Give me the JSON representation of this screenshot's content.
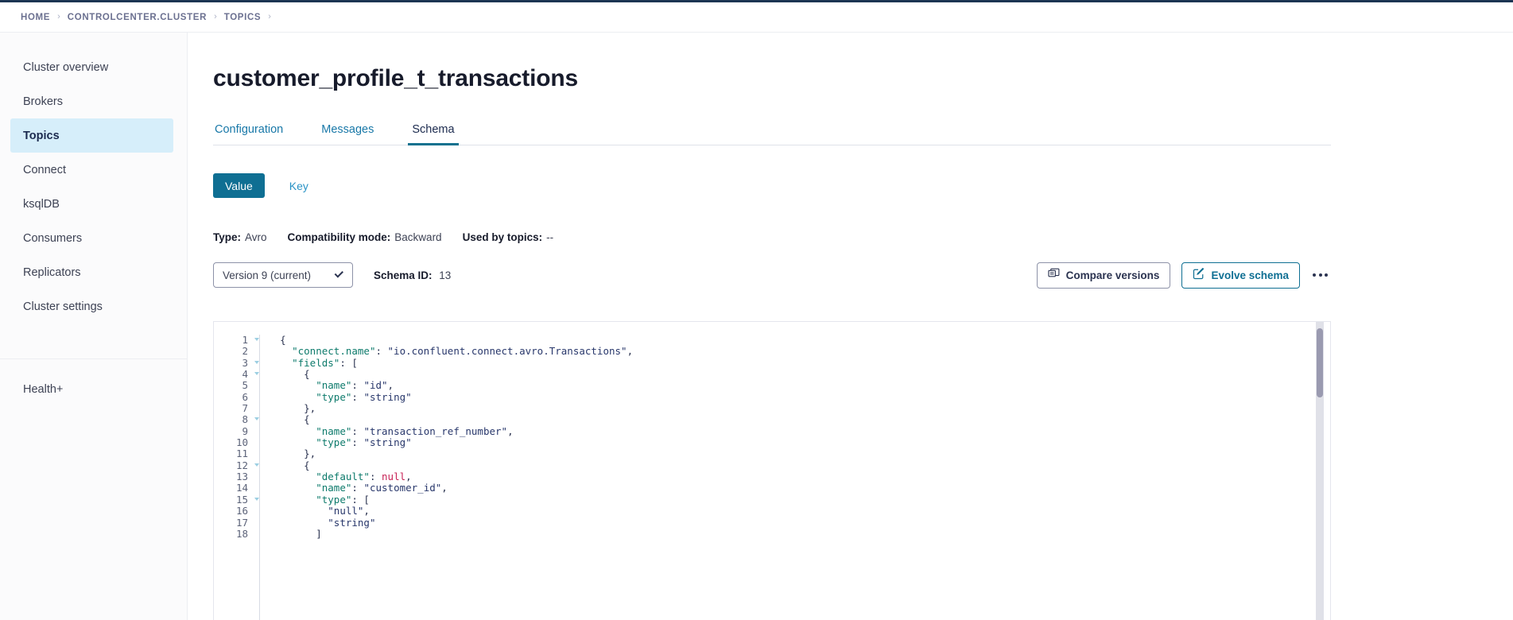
{
  "breadcrumb": {
    "items": [
      "HOME",
      "CONTROLCENTER.CLUSTER",
      "TOPICS"
    ],
    "separator": "›"
  },
  "sidebar": {
    "items": [
      {
        "label": "Cluster overview",
        "active": false
      },
      {
        "label": "Brokers",
        "active": false
      },
      {
        "label": "Topics",
        "active": true
      },
      {
        "label": "Connect",
        "active": false
      },
      {
        "label": "ksqlDB",
        "active": false
      },
      {
        "label": "Consumers",
        "active": false
      },
      {
        "label": "Replicators",
        "active": false
      },
      {
        "label": "Cluster settings",
        "active": false
      }
    ],
    "secondary": [
      {
        "label": "Health+"
      }
    ]
  },
  "main": {
    "title": "customer_profile_t_transactions",
    "tabs": [
      {
        "label": "Configuration",
        "active": false
      },
      {
        "label": "Messages",
        "active": false
      },
      {
        "label": "Schema",
        "active": true
      }
    ],
    "segmented": {
      "value_label": "Value",
      "key_label": "Key"
    },
    "meta": [
      {
        "key": "Type:",
        "value": "Avro"
      },
      {
        "key": "Compatibility mode:",
        "value": "Backward"
      },
      {
        "key": "Used by topics:",
        "value": "--"
      }
    ],
    "controls": {
      "version_select": "Version 9 (current)",
      "schema_id_key": "Schema ID:",
      "schema_id_value": "13",
      "compare_button": "Compare versions",
      "evolve_button": "Evolve schema",
      "compare_icon": "copy-pages-icon",
      "evolve_icon": "edit-square-icon",
      "overflow_icon": "ellipsis-icon"
    },
    "code": {
      "lines": [
        {
          "n": "1",
          "fold": true,
          "segments": [
            {
              "t": "  ",
              "c": "p"
            },
            {
              "t": "{",
              "c": "p"
            }
          ]
        },
        {
          "n": "2",
          "fold": false,
          "segments": [
            {
              "t": "    ",
              "c": "p"
            },
            {
              "t": "\"connect.name\"",
              "c": "k"
            },
            {
              "t": ": ",
              "c": "p"
            },
            {
              "t": "\"io.confluent.connect.avro.Transactions\"",
              "c": "s"
            },
            {
              "t": ",",
              "c": "p"
            }
          ]
        },
        {
          "n": "3",
          "fold": true,
          "segments": [
            {
              "t": "    ",
              "c": "p"
            },
            {
              "t": "\"fields\"",
              "c": "k"
            },
            {
              "t": ": [",
              "c": "p"
            }
          ]
        },
        {
          "n": "4",
          "fold": true,
          "segments": [
            {
              "t": "      ",
              "c": "p"
            },
            {
              "t": "{",
              "c": "p"
            }
          ]
        },
        {
          "n": "5",
          "fold": false,
          "segments": [
            {
              "t": "        ",
              "c": "p"
            },
            {
              "t": "\"name\"",
              "c": "k"
            },
            {
              "t": ": ",
              "c": "p"
            },
            {
              "t": "\"id\"",
              "c": "s"
            },
            {
              "t": ",",
              "c": "p"
            }
          ]
        },
        {
          "n": "6",
          "fold": false,
          "segments": [
            {
              "t": "        ",
              "c": "p"
            },
            {
              "t": "\"type\"",
              "c": "k"
            },
            {
              "t": ": ",
              "c": "p"
            },
            {
              "t": "\"string\"",
              "c": "s"
            }
          ]
        },
        {
          "n": "7",
          "fold": false,
          "segments": [
            {
              "t": "      ",
              "c": "p"
            },
            {
              "t": "},",
              "c": "p"
            }
          ]
        },
        {
          "n": "8",
          "fold": true,
          "segments": [
            {
              "t": "      ",
              "c": "p"
            },
            {
              "t": "{",
              "c": "p"
            }
          ]
        },
        {
          "n": "9",
          "fold": false,
          "segments": [
            {
              "t": "        ",
              "c": "p"
            },
            {
              "t": "\"name\"",
              "c": "k"
            },
            {
              "t": ": ",
              "c": "p"
            },
            {
              "t": "\"transaction_ref_number\"",
              "c": "s"
            },
            {
              "t": ",",
              "c": "p"
            }
          ]
        },
        {
          "n": "10",
          "fold": false,
          "segments": [
            {
              "t": "        ",
              "c": "p"
            },
            {
              "t": "\"type\"",
              "c": "k"
            },
            {
              "t": ": ",
              "c": "p"
            },
            {
              "t": "\"string\"",
              "c": "s"
            }
          ]
        },
        {
          "n": "11",
          "fold": false,
          "segments": [
            {
              "t": "      ",
              "c": "p"
            },
            {
              "t": "},",
              "c": "p"
            }
          ]
        },
        {
          "n": "12",
          "fold": true,
          "segments": [
            {
              "t": "      ",
              "c": "p"
            },
            {
              "t": "{",
              "c": "p"
            }
          ]
        },
        {
          "n": "13",
          "fold": false,
          "segments": [
            {
              "t": "        ",
              "c": "p"
            },
            {
              "t": "\"default\"",
              "c": "k"
            },
            {
              "t": ": ",
              "c": "p"
            },
            {
              "t": "null",
              "c": "n"
            },
            {
              "t": ",",
              "c": "p"
            }
          ]
        },
        {
          "n": "14",
          "fold": false,
          "segments": [
            {
              "t": "        ",
              "c": "p"
            },
            {
              "t": "\"name\"",
              "c": "k"
            },
            {
              "t": ": ",
              "c": "p"
            },
            {
              "t": "\"customer_id\"",
              "c": "s"
            },
            {
              "t": ",",
              "c": "p"
            }
          ]
        },
        {
          "n": "15",
          "fold": true,
          "segments": [
            {
              "t": "        ",
              "c": "p"
            },
            {
              "t": "\"type\"",
              "c": "k"
            },
            {
              "t": ": [",
              "c": "p"
            }
          ]
        },
        {
          "n": "16",
          "fold": false,
          "segments": [
            {
              "t": "          ",
              "c": "p"
            },
            {
              "t": "\"null\"",
              "c": "s"
            },
            {
              "t": ",",
              "c": "p"
            }
          ]
        },
        {
          "n": "17",
          "fold": false,
          "segments": [
            {
              "t": "          ",
              "c": "p"
            },
            {
              "t": "\"string\"",
              "c": "s"
            }
          ]
        },
        {
          "n": "18",
          "fold": false,
          "segments": [
            {
              "t": "        ",
              "c": "p"
            },
            {
              "t": "]",
              "c": "p"
            }
          ]
        }
      ]
    }
  },
  "colors": {
    "accent_dark": "#1c3553",
    "primary": "#0f6f93",
    "link": "#1878a8",
    "sidebar_active_bg": "#d6eefa",
    "tab_underline": "#12718f"
  }
}
